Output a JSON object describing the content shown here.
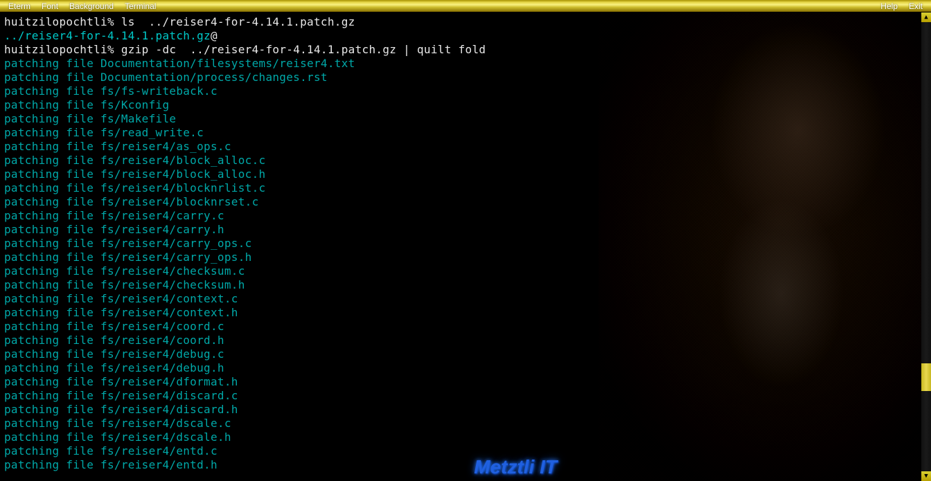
{
  "menubar": {
    "left": [
      "Eterm",
      "Font",
      "Background",
      "Terminal"
    ],
    "right": [
      "Help",
      "Exit"
    ]
  },
  "terminal": {
    "lines": [
      {
        "type": "cmd",
        "prompt": "huitzilopochtli%",
        "text": " ls  ../reiser4-for-4.14.1.patch.gz"
      },
      {
        "type": "link",
        "text": "../reiser4-for-4.14.1.patch.gz",
        "suffix": "@"
      },
      {
        "type": "cmd",
        "prompt": "huitzilopochtli%",
        "text": " gzip -dc  ../reiser4-for-4.14.1.patch.gz | quilt fold"
      },
      {
        "type": "patch",
        "text": "patching file Documentation/filesystems/reiser4.txt"
      },
      {
        "type": "patch",
        "text": "patching file Documentation/process/changes.rst"
      },
      {
        "type": "patch",
        "text": "patching file fs/fs-writeback.c"
      },
      {
        "type": "patch",
        "text": "patching file fs/Kconfig"
      },
      {
        "type": "patch",
        "text": "patching file fs/Makefile"
      },
      {
        "type": "patch",
        "text": "patching file fs/read_write.c"
      },
      {
        "type": "patch",
        "text": "patching file fs/reiser4/as_ops.c"
      },
      {
        "type": "patch",
        "text": "patching file fs/reiser4/block_alloc.c"
      },
      {
        "type": "patch",
        "text": "patching file fs/reiser4/block_alloc.h"
      },
      {
        "type": "patch",
        "text": "patching file fs/reiser4/blocknrlist.c"
      },
      {
        "type": "patch",
        "text": "patching file fs/reiser4/blocknrset.c"
      },
      {
        "type": "patch",
        "text": "patching file fs/reiser4/carry.c"
      },
      {
        "type": "patch",
        "text": "patching file fs/reiser4/carry.h"
      },
      {
        "type": "patch",
        "text": "patching file fs/reiser4/carry_ops.c"
      },
      {
        "type": "patch",
        "text": "patching file fs/reiser4/carry_ops.h"
      },
      {
        "type": "patch",
        "text": "patching file fs/reiser4/checksum.c"
      },
      {
        "type": "patch",
        "text": "patching file fs/reiser4/checksum.h"
      },
      {
        "type": "patch",
        "text": "patching file fs/reiser4/context.c"
      },
      {
        "type": "patch",
        "text": "patching file fs/reiser4/context.h"
      },
      {
        "type": "patch",
        "text": "patching file fs/reiser4/coord.c"
      },
      {
        "type": "patch",
        "text": "patching file fs/reiser4/coord.h"
      },
      {
        "type": "patch",
        "text": "patching file fs/reiser4/debug.c"
      },
      {
        "type": "patch",
        "text": "patching file fs/reiser4/debug.h"
      },
      {
        "type": "patch",
        "text": "patching file fs/reiser4/dformat.h"
      },
      {
        "type": "patch",
        "text": "patching file fs/reiser4/discard.c"
      },
      {
        "type": "patch",
        "text": "patching file fs/reiser4/discard.h"
      },
      {
        "type": "patch",
        "text": "patching file fs/reiser4/dscale.c"
      },
      {
        "type": "patch",
        "text": "patching file fs/reiser4/dscale.h"
      },
      {
        "type": "patch",
        "text": "patching file fs/reiser4/entd.c"
      },
      {
        "type": "patch",
        "text": "patching file fs/reiser4/entd.h"
      }
    ]
  },
  "watermark": "Metztli IT"
}
